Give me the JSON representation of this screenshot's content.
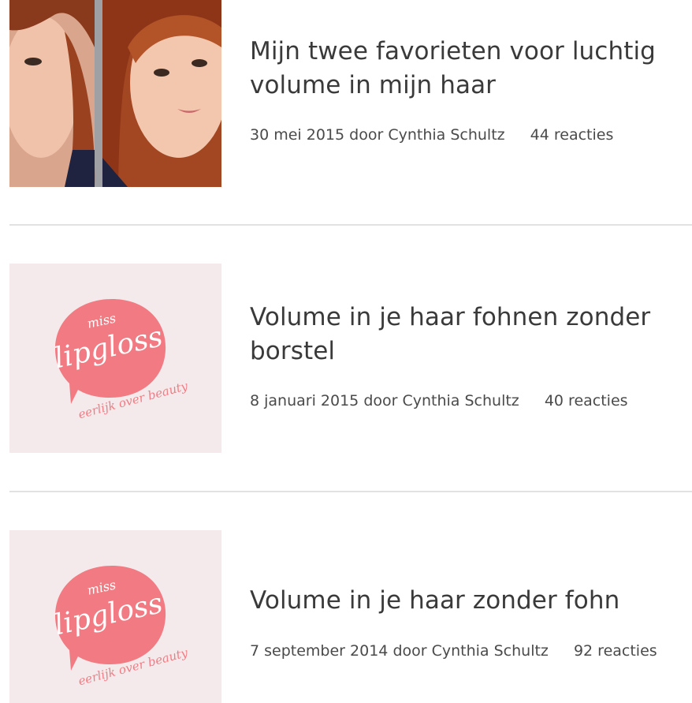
{
  "posts": [
    {
      "title": "Mijn twee favorieten voor luchtig volume in mijn haar",
      "date": "30 mei 2015",
      "by": "door",
      "author": "Cynthia Schultz",
      "comments": "44 reacties",
      "thumbnail": "photo"
    },
    {
      "title": "Volume in je haar fohnen zonder borstel",
      "date": "8 januari 2015",
      "by": "door",
      "author": "Cynthia Schultz",
      "comments": "40 reacties",
      "thumbnail": "logo"
    },
    {
      "title": "Volume in je haar zonder fohn",
      "date": "7 september 2014",
      "by": "door",
      "author": "Cynthia Schultz",
      "comments": "92 reacties",
      "thumbnail": "logo"
    }
  ],
  "logo": {
    "line1": "miss",
    "line2": "lipgloss",
    "tagline": "eerlijk over beauty"
  },
  "colors": {
    "logo_pink": "#f27b83",
    "thumb_bg": "#f5eaeb",
    "divider": "#e2e2e2",
    "text": "#3a3a3a"
  }
}
